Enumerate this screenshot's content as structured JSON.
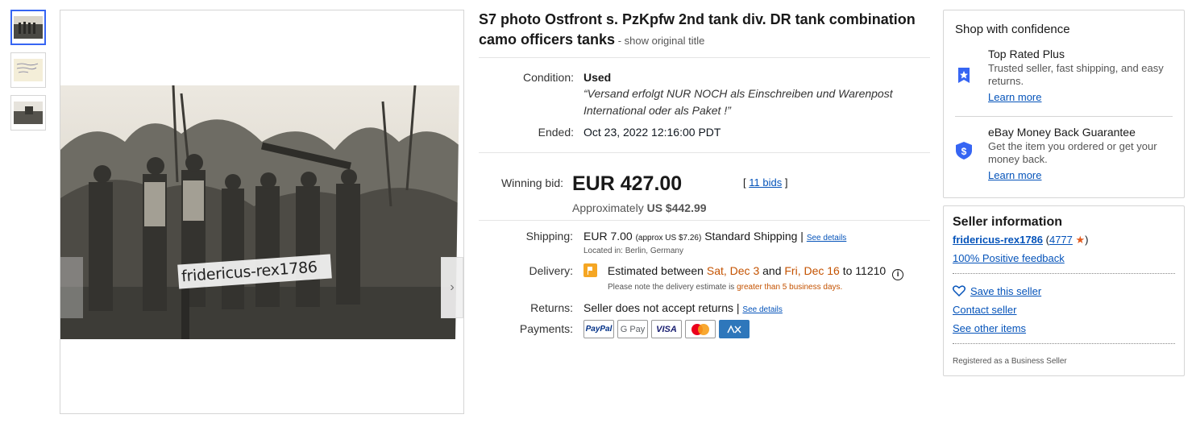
{
  "listing": {
    "title_main": "S7 photo Ostfront s. PzKpfw 2nd tank div. DR tank combination camo officers tanks",
    "title_sep": " - ",
    "show_original": "show original title",
    "watermark": "fridericus-rex1786"
  },
  "details": {
    "condition_label": "Condition:",
    "condition_value": "Used",
    "condition_quote": "“Versand erfolgt NUR NOCH als Einschreiben und Warenpost International oder als Paket !”",
    "ended_label": "Ended:",
    "ended_value": "Oct 23, 2022 12:16:00 PDT"
  },
  "bid": {
    "label": "Winning bid:",
    "price": "EUR 427.00",
    "approx_prefix": "Approximately ",
    "approx_value": "US $442.99",
    "bids_open": "[ ",
    "bids_link": "11 bids",
    "bids_close": " ]"
  },
  "shipping": {
    "label": "Shipping:",
    "price": "EUR 7.00",
    "approx": "(approx US $7.26)",
    "method": "Standard Shipping",
    "divider": " | ",
    "see_details": "See details",
    "located": "Located in: Berlin, Germany",
    "delivery_label": "Delivery:",
    "delivery_prefix": "Estimated between ",
    "delivery_date1": "Sat, Dec 3",
    "delivery_and": " and ",
    "delivery_date2": "Fri, Dec 16",
    "delivery_to": " to 11210",
    "delivery_note_prefix": "Please note the delivery estimate is ",
    "delivery_note_emph": "greater than 5 business days.",
    "returns_label": "Returns:",
    "returns_value": "Seller does not accept returns",
    "returns_see": "See details",
    "payments_label": "Payments:",
    "payment_methods": [
      "PayPal",
      "G Pay",
      "VISA",
      "Mastercard",
      "AMEX"
    ]
  },
  "confidence": {
    "title": "Shop with confidence",
    "trp_title": "Top Rated Plus",
    "trp_text": "Trusted seller, fast shipping, and easy returns.",
    "trp_link": "Learn more",
    "mbg_title": "eBay Money Back Guarantee",
    "mbg_text": "Get the item you ordered or get your money back.",
    "mbg_link": "Learn more"
  },
  "seller": {
    "title": "Seller information",
    "name": "fridericus-rex1786",
    "score_open": " (",
    "score": "4777",
    "score_close": ")",
    "feedback": "100% Positive feedback",
    "save": "Save this seller",
    "contact": "Contact seller",
    "other_items": "See other items",
    "registered": "Registered as a Business Seller"
  },
  "colors": {
    "link": "#0654ba",
    "accent_blue": "#3665f3",
    "orange": "#c45200",
    "star": "#e35c20"
  }
}
